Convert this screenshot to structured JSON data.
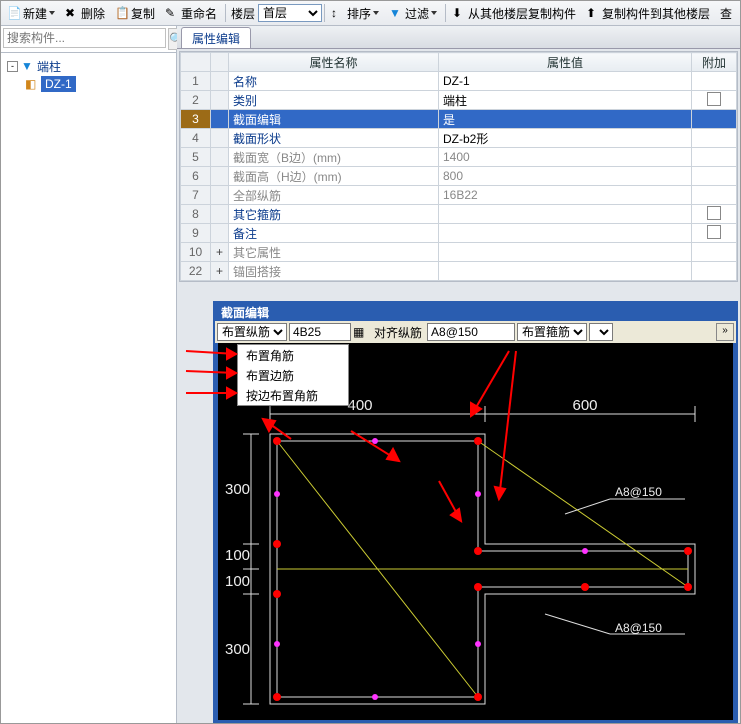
{
  "toolbar": {
    "new": "新建",
    "delete": "删除",
    "copy": "复制",
    "rename": "重命名",
    "floor": "楼层",
    "floorOptions": [
      "首层"
    ],
    "sort": "排序",
    "filter": "过滤",
    "copyFromOther": "从其他楼层复制构件",
    "copyToOther": "复制构件到其他楼层",
    "find": "查"
  },
  "search": {
    "placeholder": "搜索构件..."
  },
  "tree": {
    "root": "端柱",
    "child": "DZ-1"
  },
  "tab": {
    "prop": "属性编辑"
  },
  "grid": {
    "col_name": "属性名称",
    "col_value": "属性值",
    "col_extra": "附加",
    "rows": [
      {
        "n": "1",
        "name": "名称",
        "val": "DZ-1",
        "cls": "blue",
        "chk": false,
        "plus": ""
      },
      {
        "n": "2",
        "name": "类别",
        "val": "端柱",
        "cls": "blue",
        "chk": true,
        "plus": ""
      },
      {
        "n": "3",
        "name": "截面编辑",
        "val": "是",
        "cls": "sel",
        "chk": false,
        "plus": ""
      },
      {
        "n": "4",
        "name": "截面形状",
        "val": "DZ-b2形",
        "cls": "blue",
        "chk": false,
        "plus": ""
      },
      {
        "n": "5",
        "name": "截面宽（B边）(mm)",
        "val": "1400",
        "cls": "dim",
        "chk": false,
        "plus": ""
      },
      {
        "n": "6",
        "name": "截面高（H边）(mm)",
        "val": "800",
        "cls": "dim",
        "chk": false,
        "plus": ""
      },
      {
        "n": "7",
        "name": "全部纵筋",
        "val": "16B22",
        "cls": "dim",
        "chk": false,
        "plus": ""
      },
      {
        "n": "8",
        "name": "其它箍筋",
        "val": "",
        "cls": "blue",
        "chk": true,
        "plus": ""
      },
      {
        "n": "9",
        "name": "备注",
        "val": "",
        "cls": "blue",
        "chk": true,
        "plus": ""
      },
      {
        "n": "10",
        "name": "其它属性",
        "val": "",
        "cls": "dim",
        "chk": false,
        "plus": "+"
      },
      {
        "n": "22",
        "name": "锚固搭接",
        "val": "",
        "cls": "dim",
        "chk": false,
        "plus": "+"
      }
    ]
  },
  "editor": {
    "title": "截面编辑",
    "layoutBarSel": "布置纵筋",
    "layoutBarVal": "4B25",
    "alignBar": "对齐纵筋",
    "alignVal": "A8@150",
    "stirrupSel": "布置箍筋",
    "dims": {
      "top1": "400",
      "top2": "600",
      "left1": "300",
      "left2": "100",
      "left3": "100",
      "left4": "300"
    },
    "labels": {
      "a1": "A8@150",
      "a2": "A8@150"
    }
  },
  "ddmenu": {
    "items": [
      "布置角筋",
      "布置边筋",
      "按边布置角筋"
    ]
  }
}
